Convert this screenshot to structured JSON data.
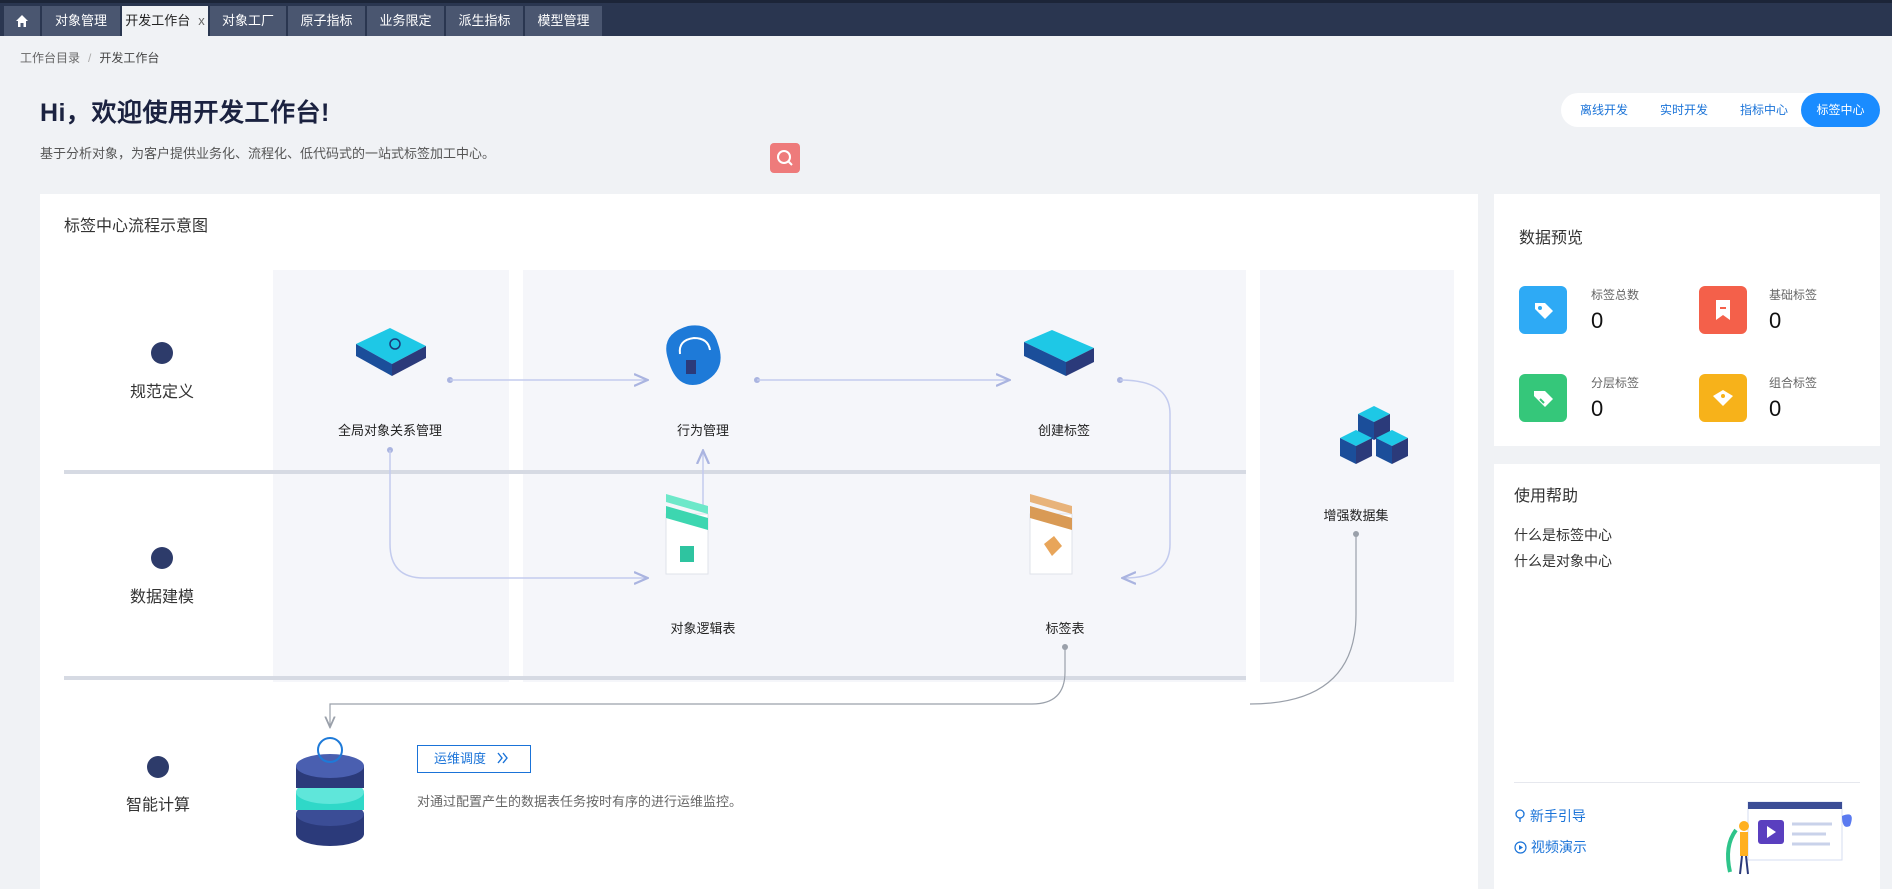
{
  "tabs": {
    "home_icon": "home-icon",
    "items": [
      "对象管理",
      "开发工作台",
      "对象工厂",
      "原子指标",
      "业务限定",
      "派生指标",
      "模型管理"
    ],
    "close_glyph": "x"
  },
  "breadcrumb": {
    "root": "工作台目录",
    "separator": "/",
    "current": "开发工作台"
  },
  "hero": {
    "title": "Hi，欢迎使用开发工作台!",
    "subtitle": "基于分析对象，为客户提供业务化、流程化、低代码式的一站式标签加工中心。"
  },
  "mode_switch": {
    "items": [
      "离线开发",
      "实时开发",
      "指标中心",
      "标签中心"
    ],
    "selected": "标签中心"
  },
  "flow": {
    "title": "标签中心流程示意图",
    "rows": [
      "规范定义",
      "数据建模",
      "智能计算"
    ],
    "nodes": {
      "global_relation": "全局对象关系管理",
      "behavior": "行为管理",
      "create_tag": "创建标签",
      "logic_table": "对象逻辑表",
      "tag_table": "标签表",
      "enhanced_dataset": "增强数据集"
    },
    "ops_button": "运维调度",
    "ops_description": "对通过配置产生的数据表任务按时有序的进行运维监控。"
  },
  "data_preview": {
    "title": "数据预览",
    "stats": [
      {
        "label": "标签总数",
        "value": "0",
        "color": "#2eaaf5",
        "icon": "tag-icon"
      },
      {
        "label": "基础标签",
        "value": "0",
        "color": "#f4604a",
        "icon": "bookmark-icon"
      },
      {
        "label": "分层标签",
        "value": "0",
        "color": "#35c77a",
        "icon": "layered-tag-icon"
      },
      {
        "label": "组合标签",
        "value": "0",
        "color": "#f7b21a",
        "icon": "combo-tag-icon"
      }
    ]
  },
  "help": {
    "title": "使用帮助",
    "links": [
      "什么是标签中心",
      "什么是对象中心"
    ],
    "guide": "新手引导",
    "video": "视频演示"
  },
  "colors": {
    "accent": "#1a8cff",
    "tabbar": "#2a3650",
    "node_blue": "#1ec8e6",
    "node_dark": "#2b3a7a"
  }
}
